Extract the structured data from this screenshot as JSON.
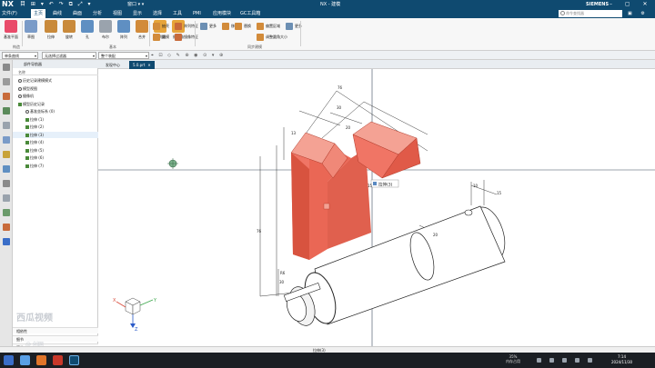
{
  "app": {
    "logo": "NX",
    "quick_access": "目 ⊞ ▾ ↶ ↷ ⧉ ⤢ ▾",
    "window_menu": "窗口 ▾ ▾",
    "title": "NX - 建模",
    "brand": "SIEMENS",
    "window_controls": "– ▢ ✕"
  },
  "menu": {
    "items": [
      "文件(F)",
      "主页",
      "曲线",
      "曲面",
      "分析",
      "视图",
      "显示",
      "选择",
      "工具",
      "PMI",
      "应用模块",
      "GC工具箱"
    ],
    "active_index": 1,
    "search_placeholder": "命令查找器",
    "right_icons": "▣ ⚙ ?"
  },
  "ribbon": {
    "big": [
      {
        "label": "基准平面",
        "color": "#e94b6a"
      },
      {
        "label": "草图",
        "color": "#7a9bc8"
      },
      {
        "label": "拉伸",
        "color": "#c98a3b"
      },
      {
        "label": "旋转",
        "color": "#c98a3b"
      },
      {
        "label": "孔",
        "color": "#5f8fc2"
      },
      {
        "label": "布尔",
        "color": "#9aa3ad"
      },
      {
        "label": "阵列",
        "color": "#5f8fc2"
      },
      {
        "label": "合并",
        "color": "#d28b3a"
      },
      {
        "label": "边倒圆",
        "color": "#e6a43a"
      },
      {
        "label": "倒斜角",
        "color": "#e6a43a"
      }
    ],
    "small": [
      {
        "label": "抽壳",
        "color": "#d28b3a"
      },
      {
        "label": "阵列特征",
        "color": "#c86a3a"
      },
      {
        "label": "拔模",
        "color": "#d28b3a"
      },
      {
        "label": "镜像特征",
        "color": "#c86a3a"
      },
      {
        "label": "更多",
        "color": "#6c8fb3"
      },
      {
        "label": "移动",
        "color": "#d28b3a"
      },
      {
        "label": "替换",
        "color": "#d28b3a"
      },
      {
        "label": "偏置区域",
        "color": "#d28b3a"
      },
      {
        "label": "调整圆角大小",
        "color": "#d28b3a"
      },
      {
        "label": "更多",
        "color": "#6c8fb3"
      }
    ],
    "groups": [
      "构造",
      "基本",
      "同步建模"
    ]
  },
  "selection": {
    "filter": "单条曲线",
    "scope": "无选择过滤器",
    "assembly": "整个装配",
    "icons": "⌖ ⊡ ◇ ✎ ⊕ ◉ ⊙ ▾ ⊕"
  },
  "tabs": [
    {
      "label": "发现中心"
    },
    {
      "label": "5.0.prt",
      "close": "✕"
    }
  ],
  "navigator": {
    "title": "部件导航器",
    "column": "名称",
    "rows": [
      {
        "label": "历史记录建模模式",
        "indent": 0,
        "icon": "gear"
      },
      {
        "label": "模型视图",
        "indent": 0,
        "icon": "box"
      },
      {
        "label": "摄像机",
        "indent": 0,
        "icon": "box"
      },
      {
        "label": "模型历史记录",
        "indent": 0,
        "icon": "check"
      },
      {
        "label": "基准坐标系 (0)",
        "indent": 1,
        "icon": "gray"
      },
      {
        "label": "拉伸 (1)",
        "indent": 1,
        "icon": "check"
      },
      {
        "label": "拉伸 (2)",
        "indent": 1,
        "icon": "check"
      },
      {
        "label": "拉伸 (3)",
        "indent": 1,
        "icon": "check"
      },
      {
        "label": "拉伸 (4)",
        "indent": 1,
        "icon": "check"
      },
      {
        "label": "拉伸 (5)",
        "indent": 1,
        "icon": "check"
      },
      {
        "label": "拉伸 (6)",
        "indent": 1,
        "icon": "check"
      },
      {
        "label": "拉伸 (7)",
        "indent": 1,
        "icon": "check"
      }
    ],
    "highlight_index": 7,
    "footer": [
      "相依性",
      "细节",
      "预览"
    ]
  },
  "viewport": {
    "callout": "拉伸(3)",
    "dims": [
      "76",
      "30",
      "20",
      "13",
      "76",
      "15",
      "30",
      "10",
      "15",
      "20",
      "R6"
    ],
    "triad": {
      "x": "X",
      "y": "Y",
      "z": "Z"
    }
  },
  "status": {
    "text": "拉伸(3)"
  },
  "taskbar": {
    "tray": [
      {
        "top": "35%",
        "bottom": "内存占用"
      },
      {
        "top": "7:14",
        "bottom": "2024/11/30"
      }
    ]
  },
  "watermark": {
    "main": "西瓜视频",
    "sub": "@ 创网"
  }
}
